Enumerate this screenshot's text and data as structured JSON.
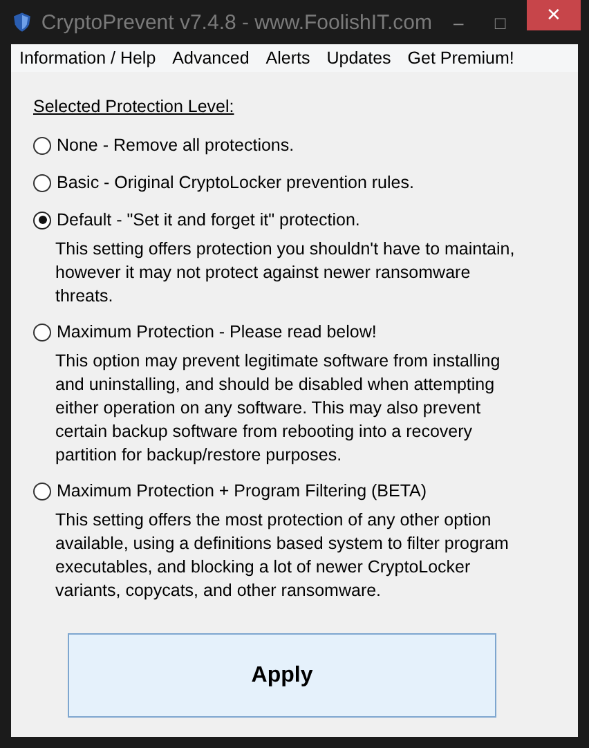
{
  "window": {
    "title": "CryptoPrevent v7.4.8 - www.FoolishIT.com",
    "controls": [
      "–",
      "□",
      "✕"
    ]
  },
  "menu": [
    "Information / Help",
    "Advanced",
    "Alerts",
    "Updates",
    "Get Premium!"
  ],
  "heading": "Selected Protection Level:",
  "options": [
    {
      "label": "None - Remove all protections.",
      "selected": false
    },
    {
      "label": "Basic - Original CryptoLocker prevention rules.",
      "selected": false
    },
    {
      "label": "Default - \"Set it and forget it\" protection.",
      "selected": true,
      "description": "This setting offers protection you shouldn't have to maintain, however it may not protect against newer ransomware threats."
    },
    {
      "label": "Maximum Protection - Please read below!",
      "selected": false,
      "description": "This option may prevent legitimate software from installing and uninstalling, and should be disabled when attempting either operation on any software.  This may also prevent certain backup software from rebooting into a recovery partition for backup/restore purposes."
    },
    {
      "label": "Maximum Protection + Program Filtering (BETA)",
      "selected": false,
      "description": "This setting offers the most protection of any other option available, using a definitions based system to filter program executables, and blocking a lot of newer CryptoLocker variants, copycats, and other ransomware."
    }
  ],
  "apply_button": "Apply"
}
